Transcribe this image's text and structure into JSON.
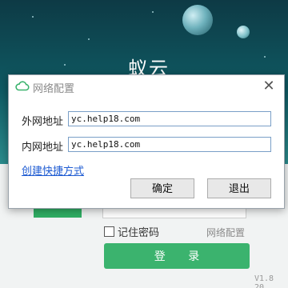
{
  "background_app": {
    "title": "蚁云",
    "remember_label": "记住密码",
    "net_config_link": "网络配置",
    "login_label": "登 录",
    "version": "V1.8 20"
  },
  "dialog": {
    "title": "网络配置",
    "external_label": "外网地址",
    "external_value": "yc.help18.com",
    "internal_label": "内网地址",
    "internal_value": "yc.help18.com",
    "shortcut_link": "创建快捷方式",
    "ok_label": "确定",
    "exit_label": "退出",
    "close_icon": "close-icon",
    "app_icon": "cloud-icon"
  },
  "colors": {
    "brand_green": "#3bb36e",
    "link_blue": "#1e5bd2"
  }
}
